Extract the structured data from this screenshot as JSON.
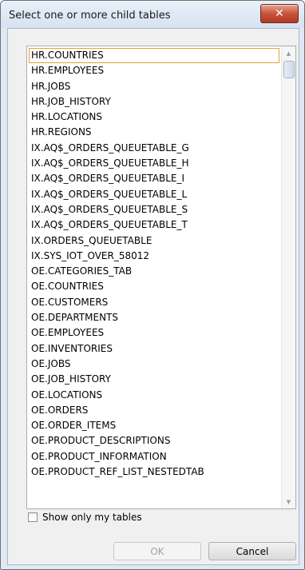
{
  "window": {
    "title": "Select one or more child tables",
    "close_glyph": "✕"
  },
  "list": {
    "items": [
      "HR.COUNTRIES",
      "HR.EMPLOYEES",
      "HR.JOBS",
      "HR.JOB_HISTORY",
      "HR.LOCATIONS",
      "HR.REGIONS",
      "IX.AQ$_ORDERS_QUEUETABLE_G",
      "IX.AQ$_ORDERS_QUEUETABLE_H",
      "IX.AQ$_ORDERS_QUEUETABLE_I",
      "IX.AQ$_ORDERS_QUEUETABLE_L",
      "IX.AQ$_ORDERS_QUEUETABLE_S",
      "IX.AQ$_ORDERS_QUEUETABLE_T",
      "IX.ORDERS_QUEUETABLE",
      "IX.SYS_IOT_OVER_58012",
      "OE.CATEGORIES_TAB",
      "OE.COUNTRIES",
      "OE.CUSTOMERS",
      "OE.DEPARTMENTS",
      "OE.EMPLOYEES",
      "OE.INVENTORIES",
      "OE.JOBS",
      "OE.JOB_HISTORY",
      "OE.LOCATIONS",
      "OE.ORDERS",
      "OE.ORDER_ITEMS",
      "OE.PRODUCT_DESCRIPTIONS",
      "OE.PRODUCT_INFORMATION",
      "OE.PRODUCT_REF_LIST_NESTEDTAB"
    ]
  },
  "show_only_my_tables": {
    "label": "Show only my tables",
    "checked": false
  },
  "buttons": {
    "ok": "OK",
    "cancel": "Cancel"
  }
}
